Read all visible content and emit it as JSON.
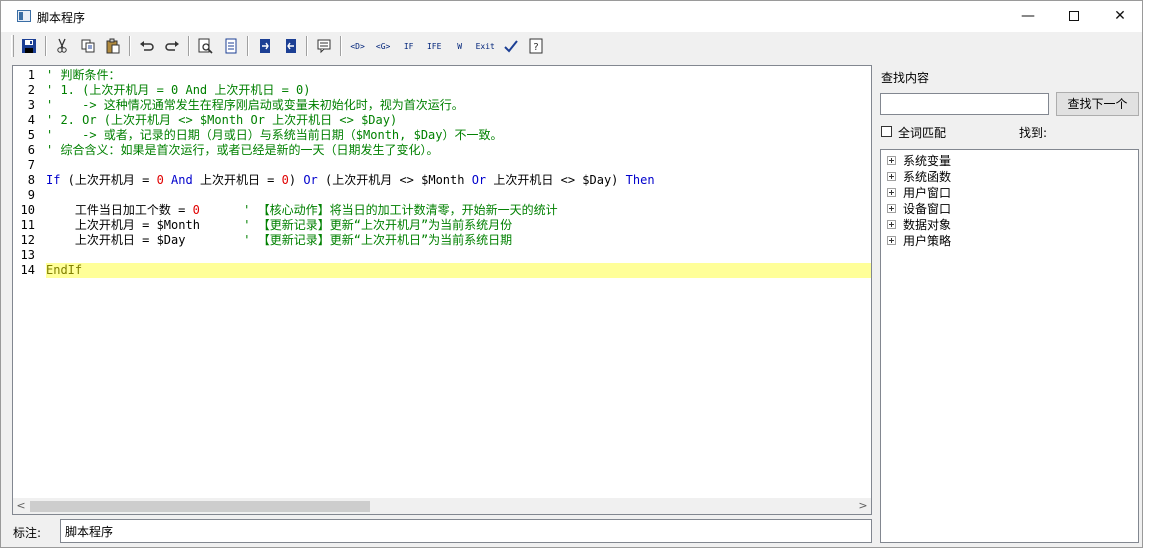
{
  "window": {
    "title": "脚本程序",
    "minimize": "—",
    "close": "✕"
  },
  "toolbar": {
    "buttons": [
      {
        "name": "save-icon"
      },
      {
        "name": "cut-icon"
      },
      {
        "name": "copy-icon"
      },
      {
        "name": "paste-icon"
      },
      {
        "name": "undo-icon"
      },
      {
        "name": "redo-icon"
      },
      {
        "name": "find-icon"
      },
      {
        "name": "page-icon"
      },
      {
        "name": "indent-icon"
      },
      {
        "name": "outdent-icon"
      },
      {
        "name": "comment-icon"
      },
      {
        "name": "insert-d-icon",
        "text": "<D>"
      },
      {
        "name": "insert-g-icon",
        "text": "<G>"
      },
      {
        "name": "insert-if-icon",
        "text": "IF"
      },
      {
        "name": "insert-ife-icon",
        "text": "IFE"
      },
      {
        "name": "insert-while-icon",
        "text": "W"
      },
      {
        "name": "insert-exit-icon",
        "text": "Exit"
      },
      {
        "name": "check-icon"
      },
      {
        "name": "help-icon"
      }
    ]
  },
  "editor": {
    "line_numbers": [
      "1",
      "2",
      "3",
      "4",
      "5",
      "6",
      "7",
      "8",
      "9",
      "10",
      "11",
      "12",
      "13",
      "14"
    ],
    "lines": [
      [
        {
          "t": "' 判断条件：",
          "c": "cm"
        }
      ],
      [
        {
          "t": "' 1. (上次开机月 = 0 And 上次开机日 = 0)",
          "c": "cm"
        }
      ],
      [
        {
          "t": "'    -> 这种情况通常发生在程序刚启动或变量未初始化时，视为首次运行。",
          "c": "cm"
        }
      ],
      [
        {
          "t": "' 2. Or (上次开机月 <> $Month Or 上次开机日 <> $Day)",
          "c": "cm"
        }
      ],
      [
        {
          "t": "'    -> 或者，记录的日期（月或日）与系统当前日期（$Month, $Day）不一致。",
          "c": "cm"
        }
      ],
      [
        {
          "t": "' 综合含义：如果是首次运行，或者已经是新的一天（日期发生了变化）。",
          "c": "cm"
        }
      ],
      [],
      [
        {
          "t": "If",
          "c": "kw"
        },
        {
          "t": " (上次开机月 = ",
          "c": "tx"
        },
        {
          "t": "0",
          "c": "num"
        },
        {
          "t": " ",
          "c": "tx"
        },
        {
          "t": "And",
          "c": "kw"
        },
        {
          "t": " 上次开机日 = ",
          "c": "tx"
        },
        {
          "t": "0",
          "c": "num"
        },
        {
          "t": ") ",
          "c": "tx"
        },
        {
          "t": "Or",
          "c": "kw"
        },
        {
          "t": " (上次开机月 <> $Month ",
          "c": "tx"
        },
        {
          "t": "Or",
          "c": "kw"
        },
        {
          "t": " 上次开机日 <> $Day) ",
          "c": "tx"
        },
        {
          "t": "Then",
          "c": "kw"
        }
      ],
      [],
      [
        {
          "t": "    工件当日加工个数 = ",
          "c": "tx"
        },
        {
          "t": "0",
          "c": "num"
        },
        {
          "t": "      ",
          "c": "tx"
        },
        {
          "t": "' 【核心动作】将当日的加工计数清零，开始新一天的统计",
          "c": "cm"
        }
      ],
      [
        {
          "t": "    上次开机月 = $Month      ",
          "c": "tx"
        },
        {
          "t": "' 【更新记录】更新“上次开机月”为当前系统月份",
          "c": "cm"
        }
      ],
      [
        {
          "t": "    上次开机日 = $Day        ",
          "c": "tx"
        },
        {
          "t": "' 【更新记录】更新“上次开机日”为当前系统日期",
          "c": "cm"
        }
      ],
      [],
      [
        {
          "t": "EndIf",
          "c": "ol"
        }
      ]
    ],
    "highlight_line": 14
  },
  "note": {
    "label": "标注:",
    "value": "脚本程序"
  },
  "search": {
    "label": "查找内容",
    "value": "",
    "button": "查找下一个",
    "whole_word": "全词匹配",
    "found": "找到:"
  },
  "tree": {
    "items": [
      "系统变量",
      "系统函数",
      "用户窗口",
      "设备窗口",
      "数据对象",
      "用户策略"
    ]
  },
  "colors": {
    "comment": "#008000",
    "keyword": "#0000cc",
    "number": "#e00000",
    "highlight": "#ffff99"
  }
}
